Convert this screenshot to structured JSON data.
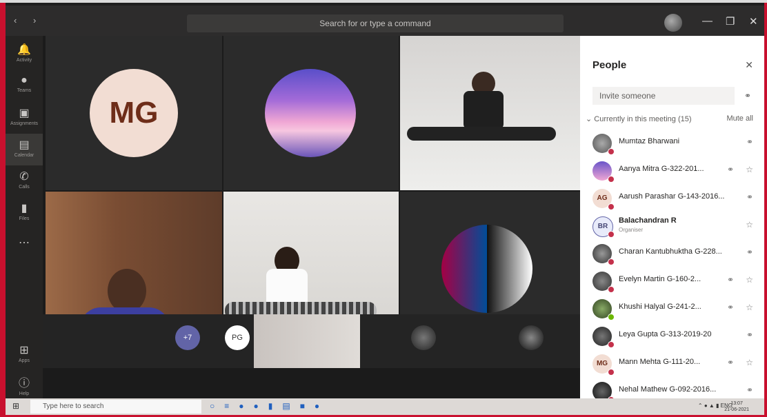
{
  "titlebar": {
    "search_placeholder": "Search for or type a command"
  },
  "rail": {
    "items": [
      {
        "label": "Activity",
        "icon": "bell-icon"
      },
      {
        "label": "Teams",
        "icon": "teams-icon"
      },
      {
        "label": "Assignments",
        "icon": "assignments-icon"
      },
      {
        "label": "Calendar",
        "icon": "calendar-icon"
      },
      {
        "label": "Calls",
        "icon": "phone-icon"
      },
      {
        "label": "Files",
        "icon": "files-icon"
      },
      {
        "label": "Apps",
        "icon": "apps-icon"
      },
      {
        "label": "Help",
        "icon": "help-icon"
      }
    ]
  },
  "stage": {
    "tile1_initials": "MG",
    "small_avatars": [
      {
        "label": "+7",
        "color": "#6264a7"
      },
      {
        "label": "PG",
        "color": "#ffffff"
      }
    ]
  },
  "people": {
    "title": "People",
    "invite_placeholder": "Invite someone",
    "section_label": "Currently in this meeting (15)",
    "mute_all": "Mute all",
    "participants": [
      {
        "name": "Mumtaz Bharwani",
        "initials": "",
        "role": ""
      },
      {
        "name": "Aanya Mitra G-322-201...",
        "initials": "",
        "role": ""
      },
      {
        "name": "Aarush Parashar G-143-2016...",
        "initials": "AG",
        "role": ""
      },
      {
        "name": "Balachandran R",
        "initials": "BR",
        "role": "Organiser"
      },
      {
        "name": "Charan Kantubhuktha G-228...",
        "initials": "",
        "role": ""
      },
      {
        "name": "Evelyn Martin G-160-2...",
        "initials": "",
        "role": ""
      },
      {
        "name": "Khushi Halyal G-241-2...",
        "initials": "",
        "role": ""
      },
      {
        "name": "Leya Gupta G-313-2019-20",
        "initials": "",
        "role": ""
      },
      {
        "name": "Mann Mehta G-111-20...",
        "initials": "MG",
        "role": ""
      },
      {
        "name": "Nehal Mathew G-092-2016...",
        "initials": "",
        "role": ""
      }
    ]
  },
  "taskbar": {
    "search_placeholder": "Type here to search",
    "time": "13:07",
    "date": "21-06-2021",
    "lang": "ENG"
  }
}
